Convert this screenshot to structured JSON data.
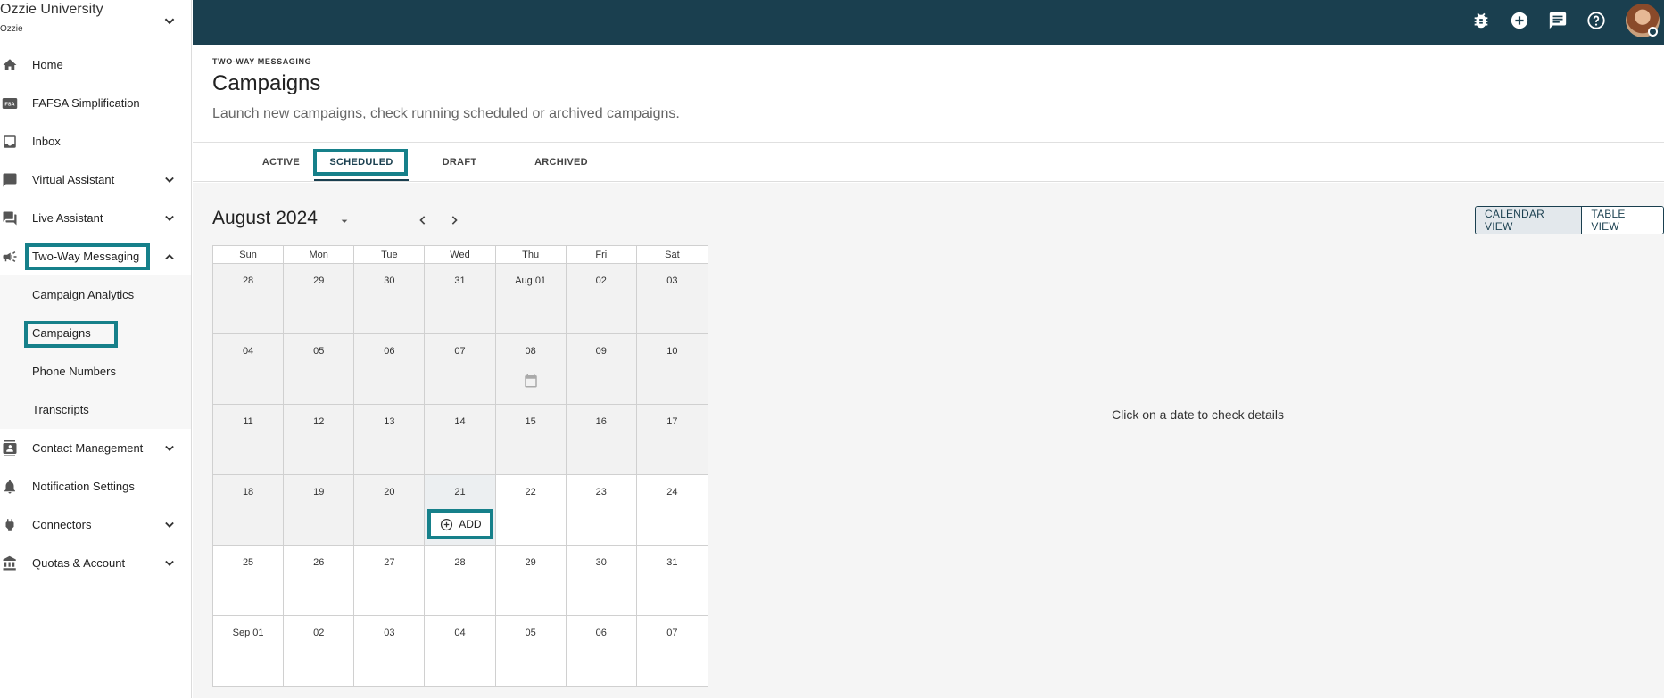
{
  "org": {
    "name": "Ozzie University",
    "sub": "Ozzie"
  },
  "sidebar": {
    "items": [
      {
        "label": "Home",
        "icon": "home-icon"
      },
      {
        "label": "FAFSA Simplification",
        "icon": "fsa-icon"
      },
      {
        "label": "Inbox",
        "icon": "inbox-icon"
      },
      {
        "label": "Virtual Assistant",
        "icon": "chat-bubble-icon",
        "expandable": true
      },
      {
        "label": "Live Assistant",
        "icon": "forum-icon",
        "expandable": true
      },
      {
        "label": "Two-Way Messaging",
        "icon": "megaphone-icon",
        "expandable": true,
        "expanded": true
      },
      {
        "label": "Contact Management",
        "icon": "contact-card-icon",
        "expandable": true
      },
      {
        "label": "Notification Settings",
        "icon": "bell-icon"
      },
      {
        "label": "Connectors",
        "icon": "plug-icon",
        "expandable": true
      },
      {
        "label": "Quotas & Account",
        "icon": "bank-icon",
        "expandable": true
      }
    ],
    "submenu": [
      {
        "label": "Campaign Analytics"
      },
      {
        "label": "Campaigns",
        "active": true
      },
      {
        "label": "Phone Numbers"
      },
      {
        "label": "Transcripts"
      }
    ]
  },
  "topbar": {
    "icons": [
      "bug-icon",
      "add-circle-icon",
      "message-icon",
      "help-icon"
    ]
  },
  "header": {
    "overline": "TWO-WAY MESSAGING",
    "title": "Campaigns",
    "description": "Launch new campaigns, check running scheduled or archived campaigns."
  },
  "tabs": [
    {
      "label": "ACTIVE"
    },
    {
      "label": "SCHEDULED",
      "active": true
    },
    {
      "label": "DRAFT"
    },
    {
      "label": "ARCHIVED"
    }
  ],
  "calendar": {
    "month_label": "August 2024",
    "weekdays": [
      "Sun",
      "Mon",
      "Tue",
      "Wed",
      "Thu",
      "Fri",
      "Sat"
    ],
    "weeks": [
      [
        "28",
        "29",
        "30",
        "31",
        "Aug 01",
        "02",
        "03"
      ],
      [
        "04",
        "05",
        "06",
        "07",
        "08",
        "09",
        "10"
      ],
      [
        "11",
        "12",
        "13",
        "14",
        "15",
        "16",
        "17"
      ],
      [
        "18",
        "19",
        "20",
        "21",
        "22",
        "23",
        "24"
      ],
      [
        "25",
        "26",
        "27",
        "28",
        "29",
        "30",
        "31"
      ],
      [
        "Sep 01",
        "02",
        "03",
        "04",
        "05",
        "06",
        "07"
      ]
    ],
    "add_label": "ADD"
  },
  "view_toggle": {
    "calendar": "CALENDAR VIEW",
    "table": "TABLE VIEW"
  },
  "empty_message": "Click on a date to check details",
  "colors": {
    "topbar": "#1a3f4f",
    "highlight": "#16808a"
  }
}
